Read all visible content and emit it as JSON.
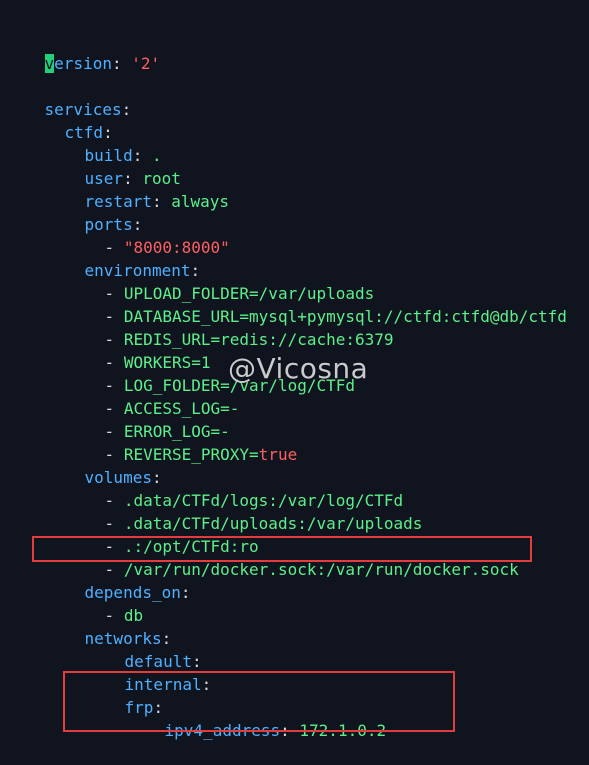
{
  "editor": {
    "line_version": {
      "cursor_char": "v",
      "rest": "ersion",
      "colon": ":",
      "value": "'2'"
    },
    "line_services": {
      "key": "services",
      "colon": ":"
    },
    "line_ctfd": {
      "key": "ctfd",
      "colon": ":"
    },
    "line_build": {
      "key": "build",
      "colon": ":",
      "value": "."
    },
    "line_user": {
      "key": "user",
      "colon": ":",
      "value": "root"
    },
    "line_restart": {
      "key": "restart",
      "colon": ":",
      "value": "always"
    },
    "line_ports": {
      "key": "ports",
      "colon": ":"
    },
    "ports_item": {
      "dash": "-",
      "value": "\"8000:8000\""
    },
    "line_environment": {
      "key": "environment",
      "colon": ":"
    },
    "env_items": [
      {
        "dash": "-",
        "value": "UPLOAD_FOLDER=/var/uploads"
      },
      {
        "dash": "-",
        "value": "DATABASE_URL=mysql+pymysql://ctfd:ctfd@db/ctfd"
      },
      {
        "dash": "-",
        "value": "REDIS_URL=redis://cache:6379"
      },
      {
        "dash": "-",
        "value": "WORKERS=1"
      },
      {
        "dash": "-",
        "value": "LOG_FOLDER=/var/log/CTFd"
      },
      {
        "dash": "-",
        "value": "ACCESS_LOG=-"
      },
      {
        "dash": "-",
        "value": "ERROR_LOG=-"
      },
      {
        "dash": "-",
        "value": "REVERSE_PROXY=",
        "bool": "true"
      }
    ],
    "line_volumes": {
      "key": "volumes",
      "colon": ":"
    },
    "volume_items": [
      {
        "dash": "-",
        "value": ".data/CTFd/logs:/var/log/CTFd"
      },
      {
        "dash": "-",
        "value": ".data/CTFd/uploads:/var/uploads"
      },
      {
        "dash": "-",
        "value": ".:/opt/CTFd:ro"
      },
      {
        "dash": "-",
        "value": "/var/run/docker.sock:/var/run/docker.sock"
      }
    ],
    "line_depends_on": {
      "key": "depends_on",
      "colon": ":"
    },
    "depends_item": {
      "dash": "-",
      "value": "db"
    },
    "line_networks": {
      "key": "networks",
      "colon": ":"
    },
    "line_default": {
      "key": "default",
      "colon": ":"
    },
    "line_internal": {
      "key": "internal",
      "colon": ":"
    },
    "line_frp": {
      "key": "frp",
      "colon": ":"
    },
    "line_ipv4": {
      "key": "ipv4_address",
      "colon": ":",
      "value": "172.1.0.2"
    }
  },
  "watermark": "@Vicosna",
  "colors": {
    "background": "#10141f",
    "key": "#4fb0ff",
    "value_green": "#5cf08a",
    "string_red": "#ff5f5f",
    "highlight_box": "#e33c3c",
    "cursor": "#21d07a"
  }
}
